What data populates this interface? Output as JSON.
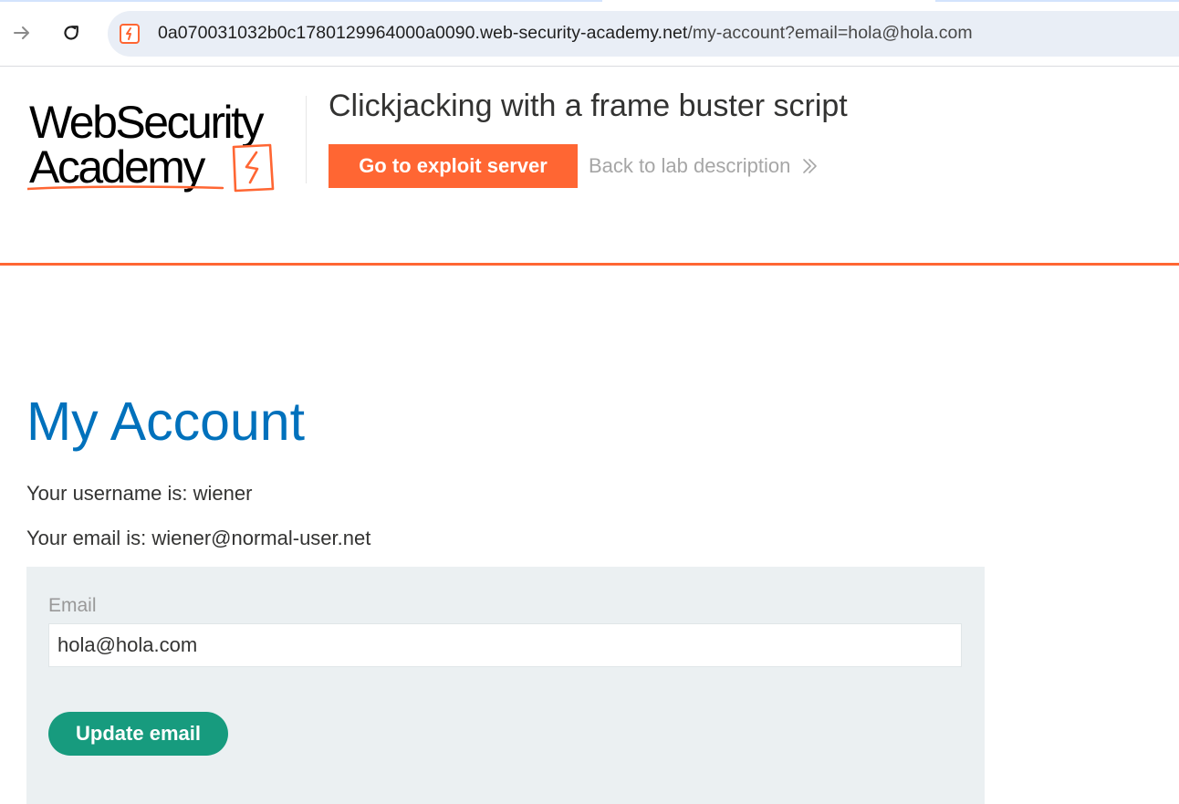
{
  "browser": {
    "url_host": "0a070031032b0c1780129964000a0090.web-security-academy.net",
    "url_path": "/my-account?email=hola@hola.com",
    "icons": {
      "forward": "arrow-right-icon",
      "reload": "reload-icon",
      "site": "web-security-academy-site-icon"
    }
  },
  "header": {
    "logo_line1": "WebSecurity",
    "logo_line2": "Academy",
    "lab_title": "Clickjacking with a frame buster script",
    "exploit_button": "Go to exploit server",
    "back_link": "Back to lab description"
  },
  "account": {
    "title": "My Account",
    "username_line": "Your username is: wiener",
    "email_line": "Your email is: wiener@normal-user.net",
    "form": {
      "email_label": "Email",
      "email_value": "hola@hola.com",
      "submit_label": "Update email"
    }
  },
  "colors": {
    "accent_orange": "#ff6633",
    "heading_blue": "#0071bc",
    "button_green": "#179b7e",
    "panel_bg": "#ebf0f2"
  }
}
